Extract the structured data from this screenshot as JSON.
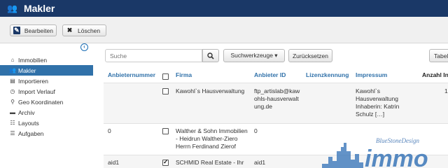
{
  "header": {
    "title": "Makler"
  },
  "toolbar": {
    "edit_label": "Bearbeiten",
    "delete_label": "Löschen"
  },
  "sidebar": {
    "items": [
      {
        "label": "Immobilien",
        "icon": "home-icon"
      },
      {
        "label": "Makler",
        "icon": "users-icon",
        "active": true
      },
      {
        "label": "Importieren",
        "icon": "import-icon"
      },
      {
        "label": "Import Verlauf",
        "icon": "history-icon"
      },
      {
        "label": "Geo Koordinaten",
        "icon": "location-icon"
      },
      {
        "label": "Archiv",
        "icon": "archive-icon"
      },
      {
        "label": "Layouts",
        "icon": "grid-icon"
      },
      {
        "label": "Aufgaben",
        "icon": "tasks-icon"
      }
    ]
  },
  "filter": {
    "search_placeholder": "Suche",
    "tools_label": "Suchwerkzeuge ▾",
    "reset_label": "Zurücksetzen",
    "table_label": "Tabell"
  },
  "table": {
    "columns": [
      "Anbieternummer",
      "Firma",
      "Anbieter ID",
      "Lizenzkennung",
      "Impressum",
      "Anzahl In"
    ],
    "rows": [
      {
        "anbieternummer": "",
        "firma": [
          "Kawohl`s Hausverwaltung"
        ],
        "anbieter_id": [
          "ftp_artislab@kaw",
          "ohls-hausverwalt",
          "ung.de"
        ],
        "lizenz": "",
        "impressum": [
          "Kawohl`s",
          "Hausverwaltung",
          "Inhaberin: Katrin",
          "Schulz […]"
        ],
        "anzahl": "1",
        "checked": false
      },
      {
        "anbieternummer": "0",
        "firma": [
          "Walther & Sohn Immobilien",
          "- Heidrun Walther-Ziero",
          "Herrn Ferdinand Zierof"
        ],
        "anbieter_id": [
          "0"
        ],
        "lizenz": "",
        "impressum": [],
        "anzahl": "",
        "checked": false
      },
      {
        "anbieternummer": "aid1",
        "firma": [
          "SCHMID Real Estate - Ihr"
        ],
        "anbieter_id": [
          "aid1"
        ],
        "lizenz": "",
        "impressum": [],
        "anzahl": "",
        "checked": true
      }
    ]
  },
  "watermark": {
    "text": "immo",
    "subtext": "BlueStoneDesign"
  },
  "colors": {
    "header_bg": "#1a3867",
    "accent": "#3071a9",
    "active_nav": "#3071a9"
  }
}
